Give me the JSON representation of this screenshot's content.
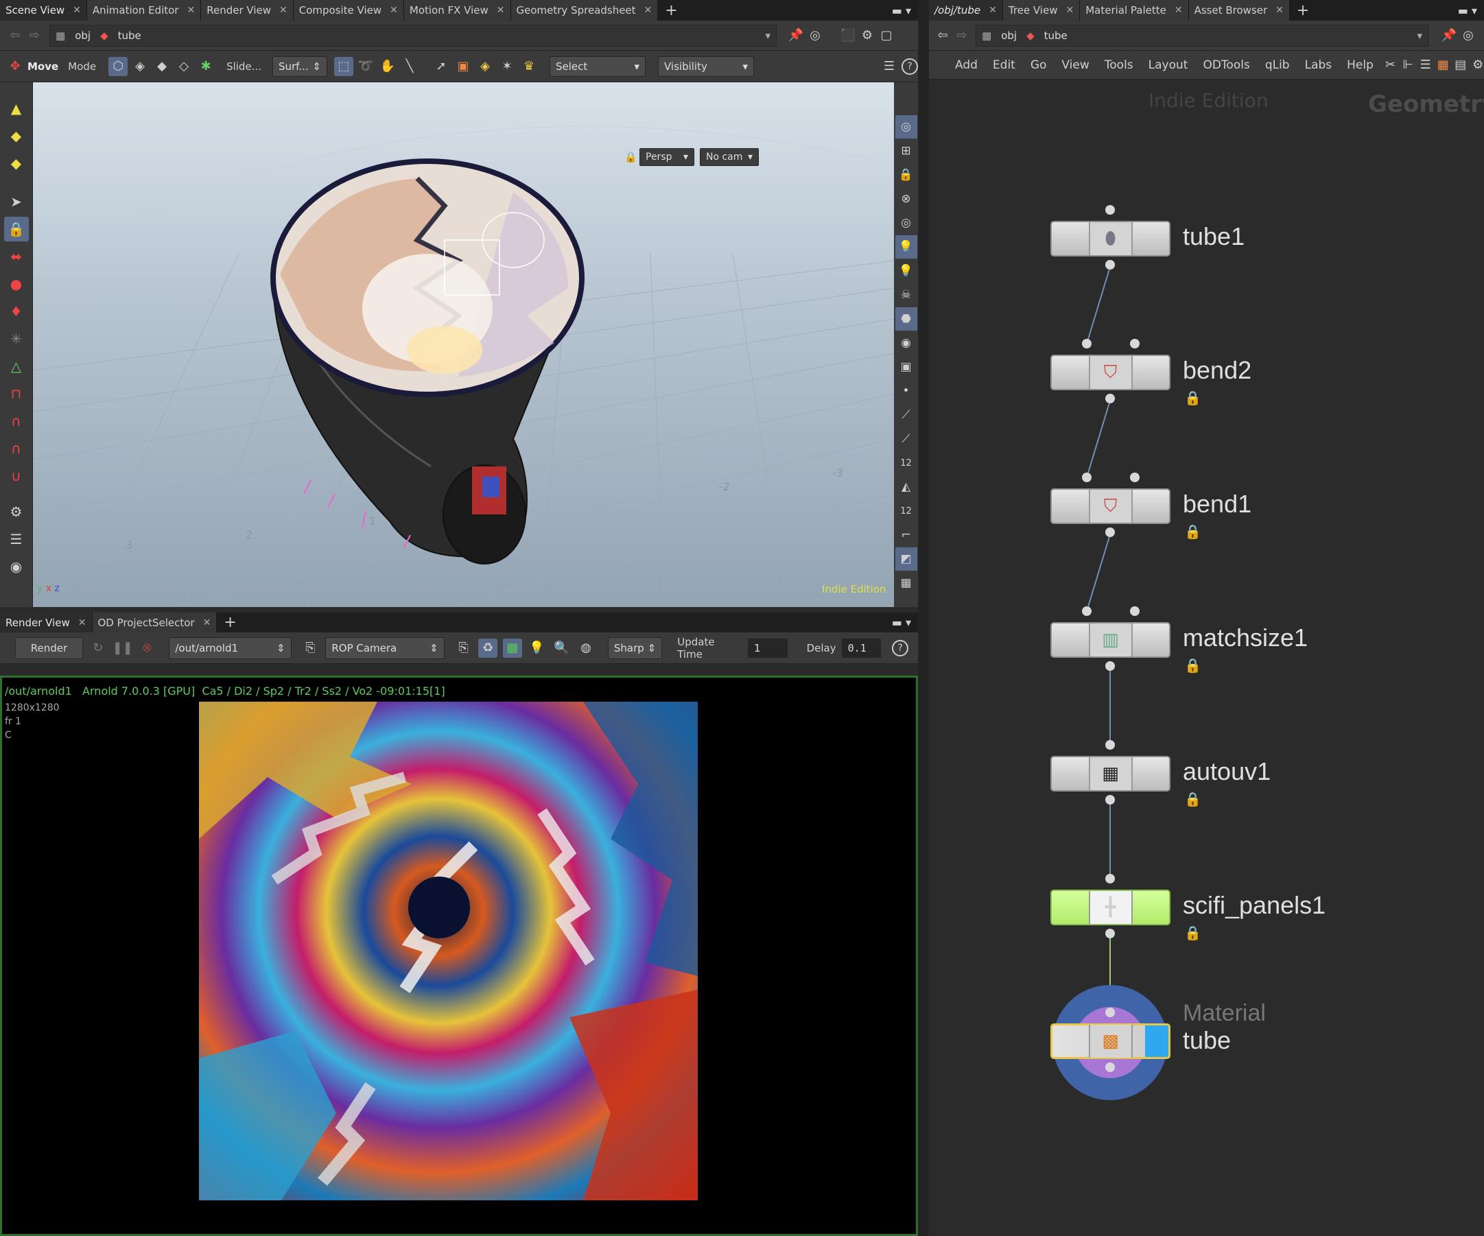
{
  "left_tabs": [
    "Scene View",
    "Animation Editor",
    "Render View",
    "Composite View",
    "Motion FX View",
    "Geometry Spreadsheet"
  ],
  "right_tabs": [
    "/obj/tube",
    "Tree View",
    "Material Palette",
    "Asset Browser"
  ],
  "path": {
    "obj": "obj",
    "tube": "tube"
  },
  "viewer_toolbar": {
    "move": "Move",
    "mode": "Mode",
    "slide": "Slide...",
    "surf": "Surf...",
    "select": "Select",
    "visibility": "Visibility"
  },
  "viewport": {
    "persp": "Persp",
    "nocam": "No cam",
    "watermark": "Indie Edition",
    "grid_labels": [
      "-3",
      "-2",
      "1",
      "2",
      "3"
    ]
  },
  "render_tabs": [
    "Render View",
    "OD ProjectSelector"
  ],
  "render_toolbar": {
    "render": "Render",
    "rop": "/out/arnold1",
    "camera": "ROP Camera",
    "sharp": "Sharp",
    "update_time_label": "Update Time",
    "update_time_value": "1",
    "delay_label": "Delay",
    "delay_value": "0.1"
  },
  "render_info": {
    "line1": "/out/arnold1   Arnold 7.0.0.3 [GPU]  Ca5 / Di2 / Sp2 / Tr2 / Ss2 / Vo2 -09:01:15[1]",
    "res": "1280x1280",
    "frame": "fr 1",
    "channel": "C"
  },
  "network_menu": [
    "Add",
    "Edit",
    "Go",
    "View",
    "Tools",
    "Layout",
    "ODTools",
    "qLib",
    "Labs",
    "Help"
  ],
  "network": {
    "edition": "Indie Edition",
    "context": "Geometry",
    "nodes": [
      {
        "name": "tube1",
        "locked": false
      },
      {
        "name": "bend2",
        "locked": true
      },
      {
        "name": "bend1",
        "locked": true
      },
      {
        "name": "matchsize1",
        "locked": true
      },
      {
        "name": "autouv1",
        "locked": true
      },
      {
        "name": "scifi_panels1",
        "locked": true
      }
    ],
    "material_label": "Material",
    "material_name": "tube"
  }
}
